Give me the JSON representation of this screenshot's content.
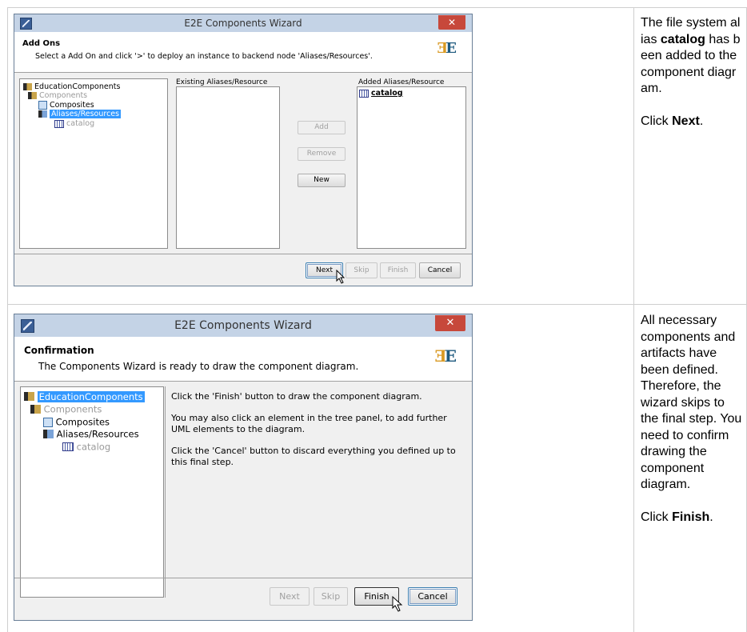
{
  "step1": {
    "window_title": "E2E Components Wizard",
    "header_title": "Add Ons",
    "header_subtitle": "Select a Add On and click '>' to deploy an instance to backend node 'Aliases/Resources'.",
    "tree": {
      "root": "EducationComponents",
      "components": "Components",
      "composites": "Composites",
      "aliases": "Aliases/Resources",
      "catalog": "catalog"
    },
    "existing_label": "Existing Aliases/Resource",
    "added_label": "Added Aliases/Resource",
    "added_item": "catalog",
    "buttons": {
      "add": "Add",
      "remove": "Remove",
      "new": "New",
      "next": "Next",
      "skip": "Skip",
      "finish": "Finish",
      "cancel": "Cancel"
    }
  },
  "step1_note": {
    "line1": "The file system alias",
    "bold": "catalog",
    "line2": "has been added to the component diagram.",
    "action_prefix": "Click",
    "action_bold": "Next",
    "action_suffix": "."
  },
  "step2": {
    "window_title": "E2E Components Wizard",
    "header_title": "Confirmation",
    "header_subtitle": "The Components Wizard is ready to draw the component diagram.",
    "tree": {
      "root": "EducationComponents",
      "components": "Components",
      "composites": "Composites",
      "aliases": "Aliases/Resources",
      "catalog": "catalog"
    },
    "info_1": "Click the 'Finish' button to draw the component diagram.",
    "info_2": "You may also click an element in the tree panel, to add further UML elements to the diagram.",
    "info_3": "Click the 'Cancel' button to discard everything you defined up to this final step.",
    "buttons": {
      "next": "Next",
      "skip": "Skip",
      "finish": "Finish",
      "cancel": "Cancel"
    }
  },
  "step2_note": {
    "text": "All necessary components and artifacts have been defined. Therefore, the wizard skips to the final step. You need to confirm drawing the component diagram.",
    "action_prefix": "Click",
    "action_bold": "Finish",
    "action_suffix": "."
  },
  "icons": {
    "app": "wizard-app-icon",
    "close": "close-icon",
    "logo": "e2e-logo",
    "cursor": "mouse-cursor-icon"
  }
}
